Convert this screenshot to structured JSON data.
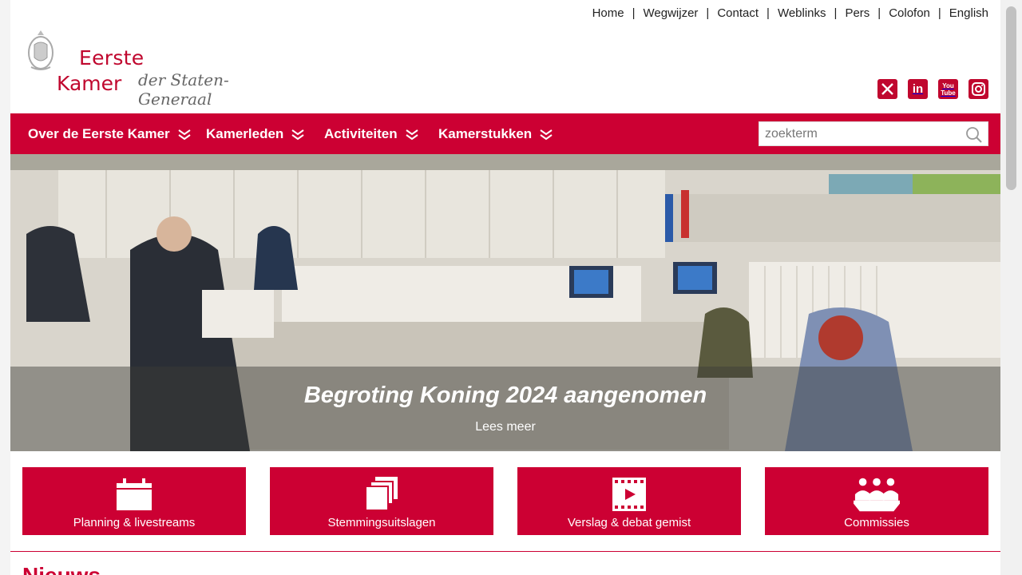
{
  "top_nav": [
    "Home",
    "Wegwijzer",
    "Contact",
    "Weblinks",
    "Pers",
    "Colofon",
    "English"
  ],
  "logo": {
    "line1": "Eerste",
    "line2": "Kamer",
    "line3": "der Staten-Generaal"
  },
  "social": [
    {
      "name": "x-icon"
    },
    {
      "name": "linkedin-icon",
      "text": "in"
    },
    {
      "name": "youtube-icon",
      "text": "You Tube"
    },
    {
      "name": "instagram-icon"
    }
  ],
  "main_nav": [
    "Over de Eerste Kamer",
    "Kamerleden",
    "Activiteiten",
    "Kamerstukken"
  ],
  "search": {
    "placeholder": "zoekterm"
  },
  "hero": {
    "headline": "Begroting Koning 2024 aangenomen",
    "link": "Lees meer"
  },
  "tiles": [
    "Planning & livestreams",
    "Stemmingsuitslagen",
    "Verslag & debat gemist",
    "Commissies"
  ],
  "news": {
    "title": "Nieuws"
  },
  "colors": {
    "brand": "#cc0033"
  }
}
